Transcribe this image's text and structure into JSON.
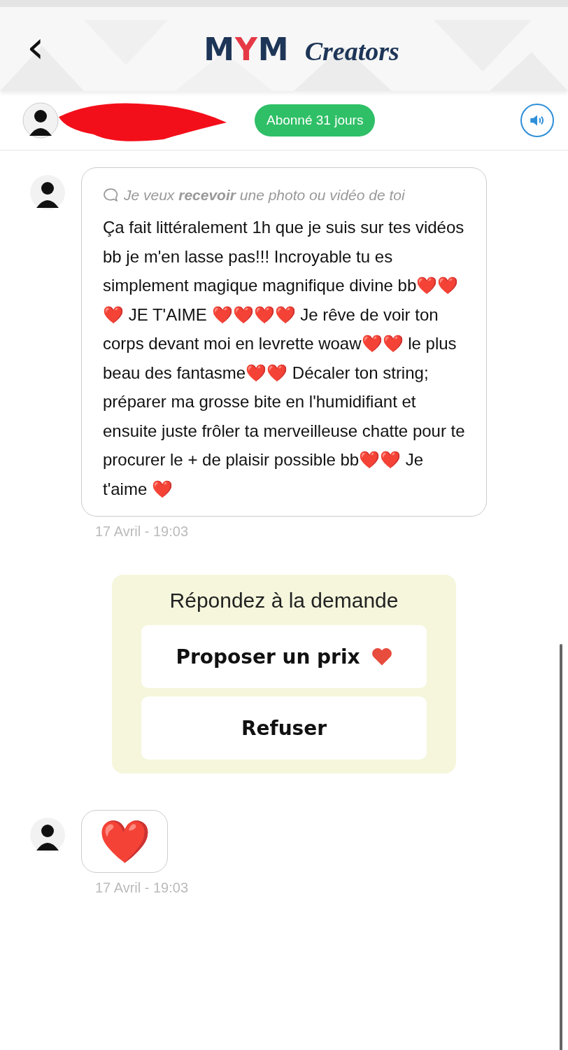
{
  "header": {
    "back_label": "‹",
    "logo_letters": [
      {
        "text": "M",
        "color": "#1d3557"
      },
      {
        "text": "Y",
        "color": "#e63946"
      },
      {
        "text": "M",
        "color": "#1d3557"
      }
    ],
    "logo_suffix": "Creators"
  },
  "subscriber": {
    "badge": "Abonné 31 jours"
  },
  "messages": [
    {
      "kind": "text",
      "request": "Je veux **recevoir** une photo ou vidéo de toi",
      "text": "Ça fait littéralement 1h que je suis sur tes vidéos bb je m'en lasse pas!!! Incroyable tu es simplement magique magnifique divine bb❤️❤️❤️ JE T'AIME ❤️❤️❤️❤️ Je rêve de voir ton corps devant moi en levrette woaw❤️❤️ le plus beau des fantasme❤️❤️ Décaler ton string; préparer ma grosse bite en l'humidifiant et ensuite juste frôler ta merveilleuse chatte pour te procurer le + de plaisir possible bb❤️❤️ Je t'aime ❤️",
      "time": "17 Avril - 19:03"
    },
    {
      "kind": "emoji",
      "text": "❤️",
      "time": "17 Avril - 19:03"
    }
  ],
  "request_card": {
    "title": "Répondez à la demande",
    "buttons": [
      {
        "label": "Proposer un prix",
        "heart": true
      },
      {
        "label": "Refuser",
        "heart": false
      }
    ]
  }
}
